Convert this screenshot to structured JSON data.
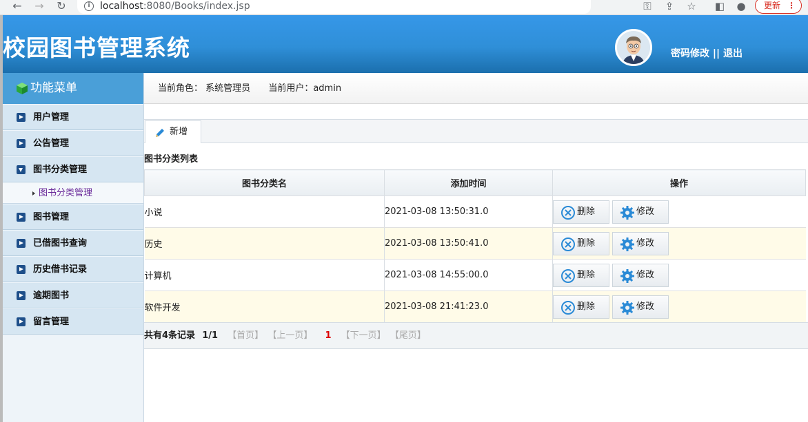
{
  "browser": {
    "url_host": "localhost",
    "url_rest": ":8080/Books/index.jsp",
    "update_label": "更新",
    "icons": [
      "back-icon",
      "forward-icon",
      "reload-icon",
      "info-icon",
      "key-icon",
      "share-icon",
      "star-icon",
      "sidepanel-icon",
      "profile-icon",
      "menu-dots-icon"
    ]
  },
  "header": {
    "title": "校园图书管理系统",
    "change_password": "密码修改",
    "separator": "||",
    "logout": "退出"
  },
  "sidebar": {
    "title": "功能菜单",
    "items": [
      {
        "label": "用户管理"
      },
      {
        "label": "公告管理"
      },
      {
        "label": "图书分类管理",
        "open": true,
        "sub": "图书分类管理"
      },
      {
        "label": "图书管理"
      },
      {
        "label": "已借图书查询"
      },
      {
        "label": "历史借书记录"
      },
      {
        "label": "逾期图书"
      },
      {
        "label": "留言管理"
      }
    ]
  },
  "main": {
    "role_label": "当前角色：",
    "role_value": "系统管理员",
    "user_label": "当前用户：",
    "user_value": "admin",
    "add_label": "新增",
    "list_title": "图书分类列表",
    "columns": [
      "图书分类名",
      "添加时间",
      "操作"
    ],
    "rows": [
      {
        "name": "小说",
        "time": "2021-03-08 13:50:31.0"
      },
      {
        "name": "历史",
        "time": "2021-03-08 13:50:41.0"
      },
      {
        "name": "计算机",
        "time": "2021-03-08 14:55:00.0"
      },
      {
        "name": "软件开发",
        "time": "2021-03-08 21:41:23.0"
      }
    ],
    "delete_label": "删除",
    "edit_label": "修改",
    "pager": {
      "total": "共有4条记录",
      "pages": "1/1",
      "first": "【首页】",
      "prev": "【上一页】",
      "current": "1",
      "next": "【下一页】",
      "last": "【尾页】"
    }
  },
  "colors": {
    "header": "#2f8fd8",
    "menu_title": "#4a9fd8",
    "row_alt": "#fffbe8",
    "pager_current": "#dd0000"
  }
}
